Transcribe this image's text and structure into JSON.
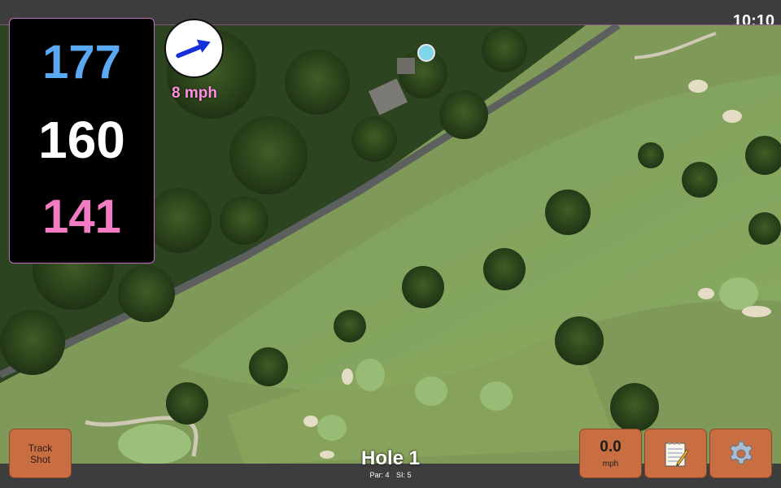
{
  "status": {
    "time": "10:10"
  },
  "distances": {
    "back": "177",
    "middle": "160",
    "front": "141"
  },
  "wind": {
    "speed": "8 mph",
    "icon": "wind-arrow-icon"
  },
  "buttons": {
    "track_shot_line1": "Track",
    "track_shot_line2": "Shot",
    "speed_value": "0.0",
    "speed_unit": "mph",
    "notes_icon": "notepad-icon",
    "settings_icon": "gear-icon"
  },
  "hole": {
    "title": "Hole 1",
    "par": "Par: 4",
    "si": "SI: 5"
  },
  "colors": {
    "back_distance": "#5aa9f2",
    "middle_distance": "#ffffff",
    "front_distance": "#f27bc3",
    "button_bg": "#c96e43",
    "wind_label": "#ff8fe0"
  }
}
